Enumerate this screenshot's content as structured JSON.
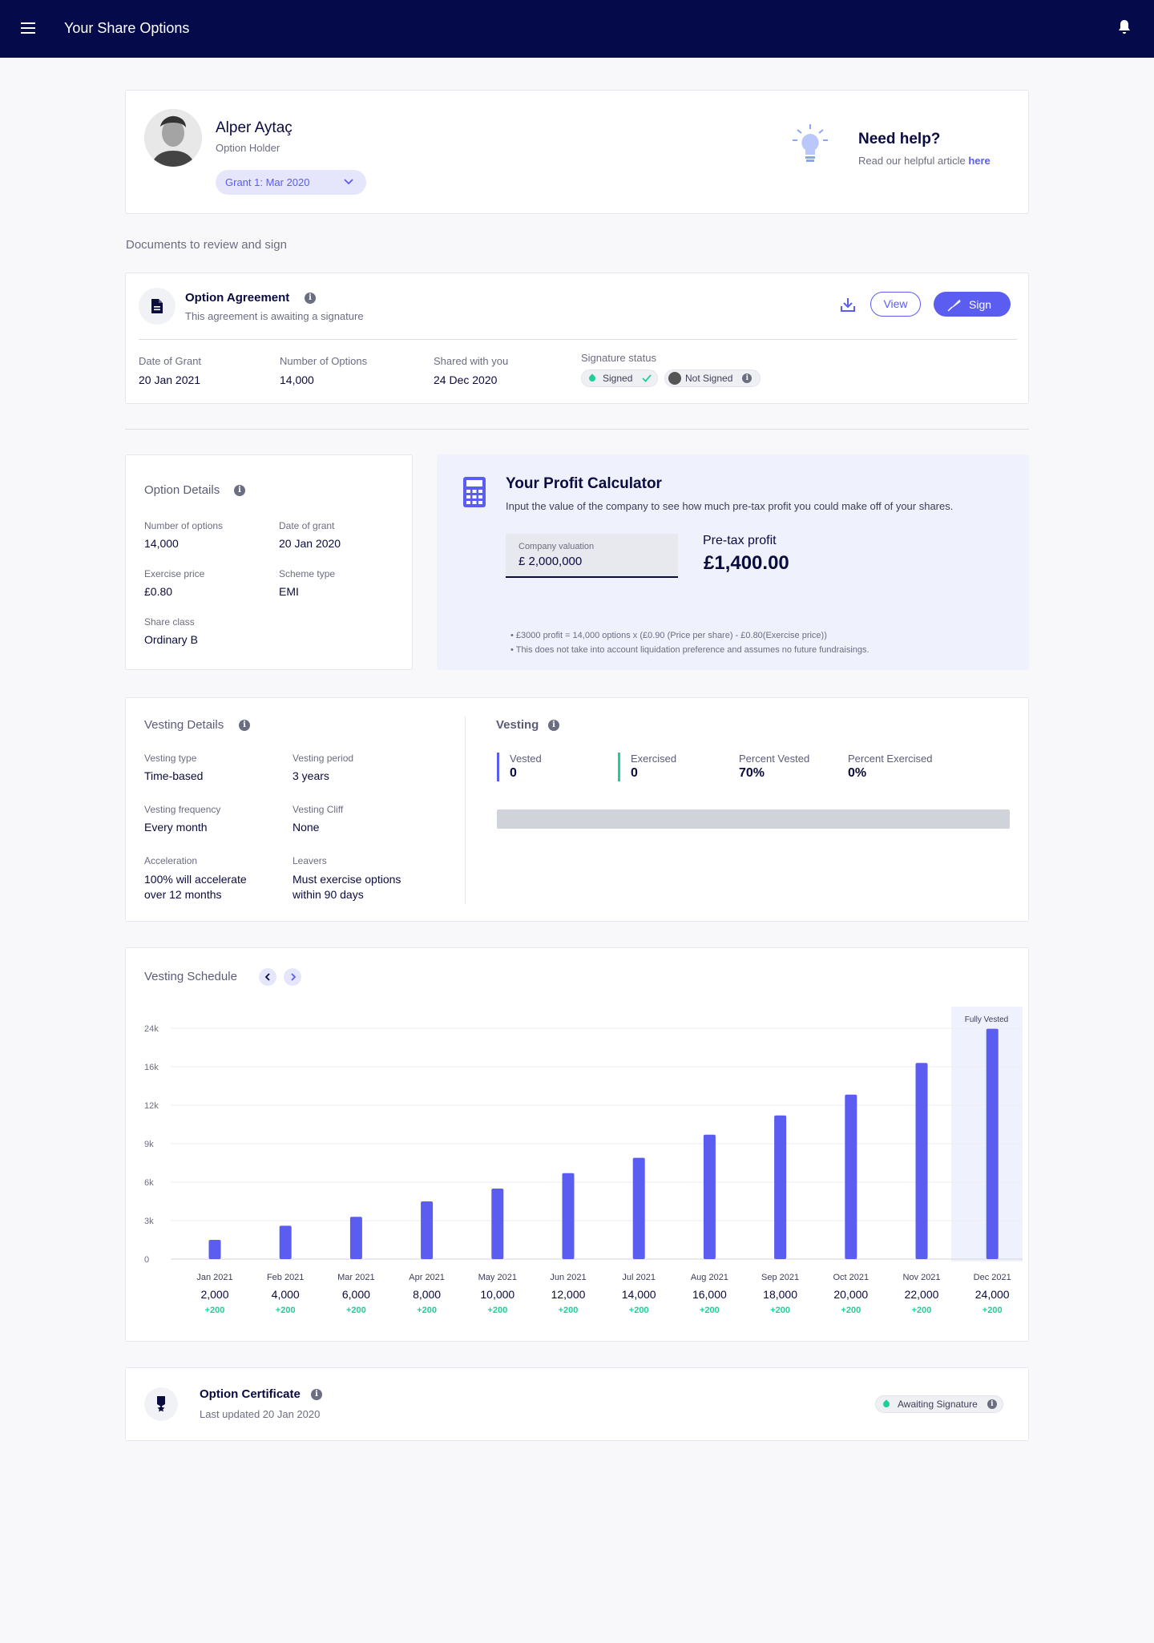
{
  "header": {
    "title": "Your Share Options"
  },
  "profile": {
    "name": "Alper Aytaç",
    "role": "Option Holder",
    "grant_select": "Grant 1: Mar 2020"
  },
  "help": {
    "title": "Need help?",
    "text": "Read our helpful article",
    "link": "here"
  },
  "documents": {
    "section_title": "Documents to review and sign",
    "title": "Option Agreement",
    "subtitle": "This agreement is awaiting a signature",
    "view_label": "View",
    "sign_label": "Sign",
    "fields": [
      {
        "label": "Date of Grant",
        "value": "20 Jan 2021"
      },
      {
        "label": "Number of Options",
        "value": "14,000"
      },
      {
        "label": "Shared with you",
        "value": "24 Dec 2020"
      }
    ],
    "signature_status_label": "Signature status",
    "signed_label": "Signed",
    "not_signed_label": "Not Signed"
  },
  "option_details": {
    "title": "Option Details",
    "fields": [
      {
        "label": "Number of options",
        "value": "14,000"
      },
      {
        "label": "Date of grant",
        "value": "20 Jan 2020"
      },
      {
        "label": "Exercise price",
        "value": "£0.80"
      },
      {
        "label": "Scheme type",
        "value": "EMI"
      },
      {
        "label": "Share class",
        "value": "Ordinary B"
      }
    ]
  },
  "calculator": {
    "title": "Your Profit Calculator",
    "description": "Input the value of the company to see how much pre-tax profit you could make off of your shares.",
    "input_label": "Company valuation",
    "input_value": "£ 2,000,000",
    "profit_label": "Pre-tax profit",
    "profit_value": "£1,400.00",
    "notes": [
      "£3000 profit = 14,000 options x (£0.90 (Price per share) - £0.80(Exercise price))",
      "This does not take into account liquidation preference and assumes no future fundraisings."
    ]
  },
  "vesting_details": {
    "title": "Vesting Details",
    "fields": [
      {
        "label": "Vesting type",
        "value": "Time-based"
      },
      {
        "label": "Vesting period",
        "value": "3 years"
      },
      {
        "label": "Vesting frequency",
        "value": "Every month"
      },
      {
        "label": "Vesting Cliff",
        "value": "None"
      },
      {
        "label": "Acceleration",
        "value": "100% will accelerate over 12 months"
      },
      {
        "label": "Leavers",
        "value": "Must exercise options within 90 days"
      }
    ]
  },
  "vesting": {
    "title": "Vesting",
    "stats": [
      {
        "label": "Vested",
        "value": "0"
      },
      {
        "label": "Exercised",
        "value": "0"
      },
      {
        "label": "Percent Vested",
        "value": "70%"
      },
      {
        "label": "Percent Exercised",
        "value": "0%"
      }
    ],
    "bar_fraction": 0,
    "colors": {
      "vested": "#5b5cf0",
      "exercised": "#1fcf98",
      "bar_track": "#d1d3db"
    }
  },
  "schedule": {
    "title": "Vesting Schedule",
    "fully_vested_label": "Fully Vested",
    "months": [
      "Jan 2021",
      "Feb 2021",
      "Mar 2021",
      "Apr 2021",
      "May 2021",
      "Jun 2021",
      "Jul 2021",
      "Aug 2021",
      "Sep 2021",
      "Oct 2021",
      "Nov 2021",
      "Dec 2021"
    ],
    "totals": [
      "2,000",
      "4,000",
      "6,000",
      "8,000",
      "10,000",
      "12,000",
      "14,000",
      "16,000",
      "18,000",
      "20,000",
      "22,000",
      "24,000"
    ],
    "increments": [
      "+200",
      "+200",
      "+200",
      "+200",
      "+200",
      "+200",
      "+200",
      "+200",
      "+200",
      "+200",
      "+200",
      "+200"
    ],
    "colors": {
      "bar": "#5b5cf0",
      "increment": "#1fcf98",
      "highlight": "#eff2fc"
    }
  },
  "chart_data": {
    "type": "bar",
    "categories": [
      "Jan 2021",
      "Feb 2021",
      "Mar 2021",
      "Apr 2021",
      "May 2021",
      "Jun 2021",
      "Jul 2021",
      "Aug 2021",
      "Sep 2021",
      "Oct 2021",
      "Nov 2021",
      "Dec 2021"
    ],
    "values": [
      1500,
      2600,
      3300,
      4500,
      5500,
      6700,
      7900,
      9700,
      11200,
      13100,
      16800,
      23900
    ],
    "y_tick_labels": [
      "0",
      "3k",
      "6k",
      "9k",
      "12k",
      "16k",
      "24k"
    ],
    "grid": true
  },
  "certificate": {
    "title": "Option Certificate",
    "subtitle": "Last updated 20 Jan 2020",
    "status": "Awaiting Signature"
  }
}
